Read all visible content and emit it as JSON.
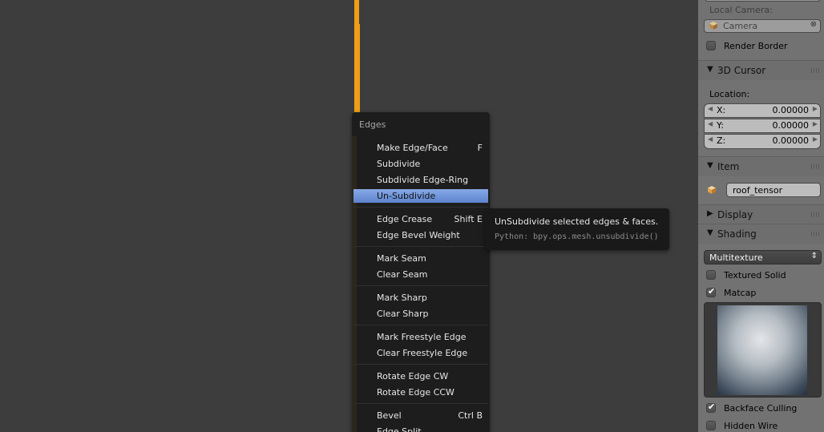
{
  "menu": {
    "title": "Edges",
    "items": [
      {
        "label": "Make Edge/Face",
        "shortcut": "F"
      },
      {
        "label": "Subdivide",
        "shortcut": ""
      },
      {
        "label": "Subdivide Edge-Ring",
        "shortcut": ""
      },
      {
        "label": "Un-Subdivide",
        "shortcut": "",
        "active": true
      },
      {
        "label": "Edge Crease",
        "shortcut": "Shift E"
      },
      {
        "label": "Edge Bevel Weight",
        "shortcut": ""
      },
      {
        "label": "Mark Seam",
        "shortcut": ""
      },
      {
        "label": "Clear Seam",
        "shortcut": ""
      },
      {
        "label": "Mark Sharp",
        "shortcut": ""
      },
      {
        "label": "Clear Sharp",
        "shortcut": ""
      },
      {
        "label": "Mark Freestyle Edge",
        "shortcut": ""
      },
      {
        "label": "Clear Freestyle Edge",
        "shortcut": ""
      },
      {
        "label": "Rotate Edge CW",
        "shortcut": ""
      },
      {
        "label": "Rotate Edge CCW",
        "shortcut": ""
      },
      {
        "label": "Bevel",
        "shortcut": "Ctrl B"
      },
      {
        "label": "Edge Split",
        "shortcut": ""
      }
    ]
  },
  "tooltip": {
    "description": "UnSubdivide selected edges & faces.",
    "python": "Python: bpy.ops.mesh.unsubdivide()"
  },
  "panel": {
    "local_camera_label": "Local Camera:",
    "camera_value": "Camera",
    "render_border": "Render Border",
    "cursor": {
      "title": "3D Cursor",
      "location_label": "Location:",
      "x_label": "X:",
      "x_value": "0.00000",
      "y_label": "Y:",
      "y_value": "0.00000",
      "z_label": "Z:",
      "z_value": "0.00000"
    },
    "item": {
      "title": "Item",
      "name": "roof_tensor"
    },
    "display": {
      "title": "Display"
    },
    "shading": {
      "title": "Shading",
      "mode": "Multitexture",
      "textured_solid": "Textured Solid",
      "textured_solid_checked": false,
      "matcap": "Matcap",
      "matcap_checked": true,
      "backface_culling": "Backface Culling",
      "backface_culling_checked": true,
      "hidden_wire": "Hidden Wire",
      "hidden_wire_checked": false
    }
  },
  "colors": {
    "accent": "#5d83cd",
    "selected_edge": "#f29d18",
    "viewport_bg": "#3d3d3d",
    "panel_bg": "#727272"
  }
}
